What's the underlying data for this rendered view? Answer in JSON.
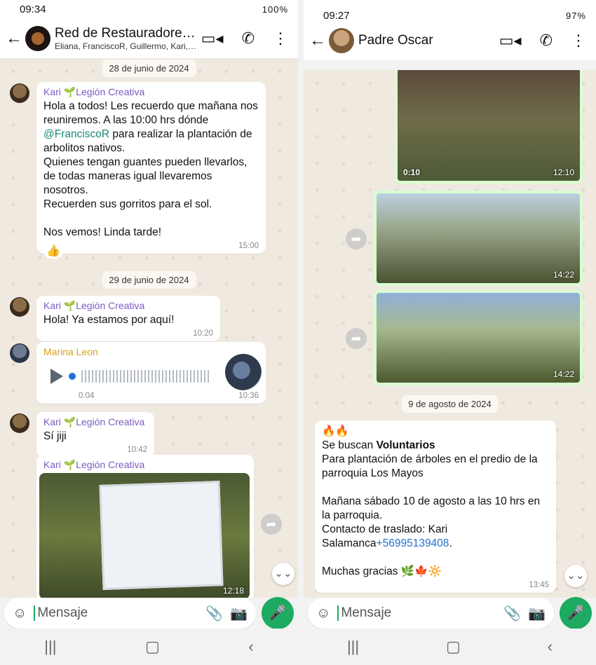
{
  "left": {
    "status": {
      "time": "09:34",
      "battery": "100%"
    },
    "header": {
      "title": "Red de Restauradores Sa...",
      "subtitle": "Eliana, FranciscoR, Guillermo, Kari, ..."
    },
    "dates": [
      "28 de junio de 2024",
      "29 de junio de 2024"
    ],
    "messages": [
      {
        "sender": "Kari 🌱Legión Creativa",
        "time": "15:00",
        "reaction": "👍",
        "text_before": "Hola a todos! Les recuerdo que mañana nos reuniremos. A las 10:00 hrs dónde ",
        "mention": "@FranciscoR",
        "text_after": " para realizar la plantación de arbolitos nativos.\nQuienes tengan guantes pueden llevarlos, de todas maneras igual llevaremos nosotros.\nRecuerden sus gorritos para el sol.\n\nNos vemos! Linda tarde!"
      },
      {
        "sender": "Kari 🌱Legión Creativa",
        "text": "Hola! Ya estamos por aquí!",
        "time": "10:20"
      },
      {
        "sender": "Marina Leon",
        "duration": "0:04",
        "time": "10:36"
      },
      {
        "sender": "Kari 🌱Legión Creativa",
        "text": "Sí jiji",
        "time": "10:42"
      },
      {
        "sender": "Kari 🌱Legión Creativa",
        "time": "12:18"
      }
    ],
    "composer": {
      "placeholder": "Mensaje"
    }
  },
  "right": {
    "status": {
      "time": "09:27",
      "battery": "97%"
    },
    "header": {
      "title": "Padre Oscar"
    },
    "photos": [
      {
        "duration": "0:10",
        "time": "12:10"
      },
      {
        "time": "14:22"
      },
      {
        "time": "14:22"
      }
    ],
    "date": "9 de agosto de 2024",
    "message": {
      "emoji_line": "🔥🔥",
      "line1_pre": "Se buscan ",
      "line1_bold": "Voluntarios",
      "body": "Para plantación de árboles en el predio de la parroquia Los Mayos\n\nMañana sábado 10 de agosto a las 10 hrs en la parroquia.\nContacto de traslado: Kari Salamanca",
      "phone": "+56995139408",
      "after_phone": ".",
      "closing": "Muchas gracias 🌿🍁🔆",
      "time": "13:45"
    },
    "composer": {
      "placeholder": "Mensaje"
    }
  },
  "icons": {
    "back": "←",
    "video": "▭◂",
    "call": "✆",
    "more": "⋮",
    "emoji": "☺",
    "attach": "📎",
    "camera": "📷",
    "mic": "🎤",
    "share": "➦",
    "scroll_down": "⌄⌄",
    "nav_recent": "|||",
    "nav_home": "▢",
    "nav_back": "‹"
  },
  "colors": {
    "accent_green": "#1daa61",
    "sender_purple": "#7b5cc4",
    "sender_gold": "#d6a21d",
    "mention_teal": "#178a7a",
    "link_blue": "#1f6fd0"
  }
}
